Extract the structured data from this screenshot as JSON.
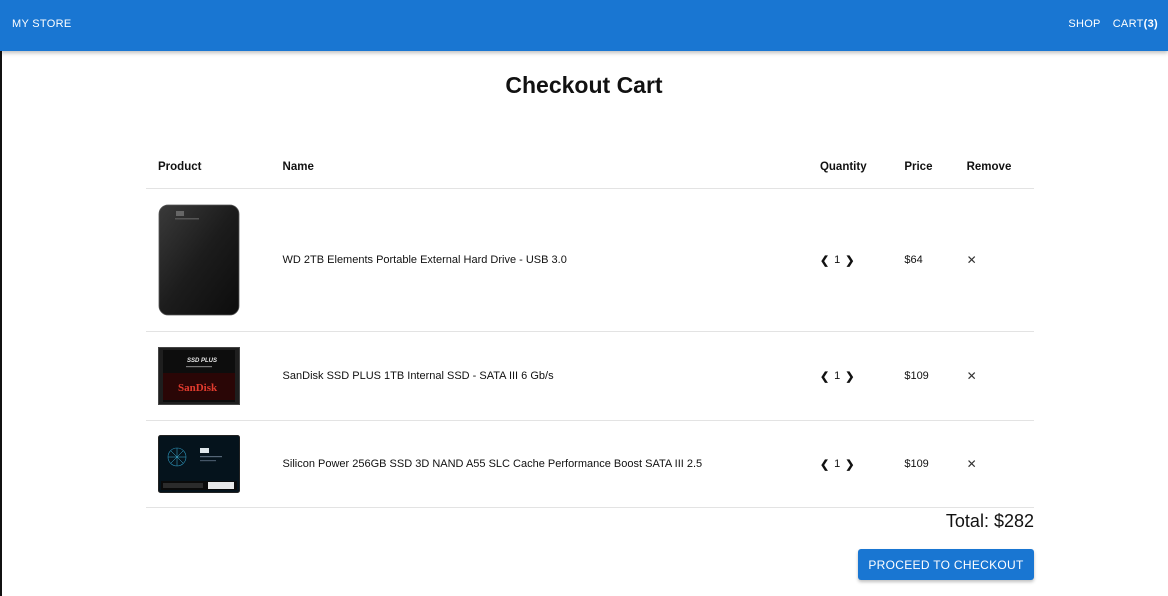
{
  "header": {
    "brand": "MY STORE",
    "nav_shop": "SHOP",
    "nav_cart": "CART",
    "cart_count": "(3)"
  },
  "page": {
    "title": "Checkout Cart"
  },
  "table": {
    "columns": [
      "Product",
      "Name",
      "Quantity",
      "Price",
      "Remove"
    ],
    "rows": [
      {
        "image": "wd-hard-drive-image",
        "name": "WD 2TB Elements Portable External Hard Drive - USB 3.0",
        "quantity": "1",
        "price": "$64"
      },
      {
        "image": "sandisk-ssd-image",
        "name": "SanDisk SSD PLUS 1TB Internal SSD - SATA III 6 Gb/s",
        "quantity": "1",
        "price": "$109",
        "image_text_1": "SSD PLUS",
        "image_text_2": "SanDisk"
      },
      {
        "image": "silicon-power-ssd-image",
        "name": "Silicon Power 256GB SSD 3D NAND A55 SLC Cache Performance Boost SATA III 2.5",
        "quantity": "1",
        "price": "$109"
      }
    ],
    "decrement_glyph": "❮",
    "increment_glyph": "❯",
    "remove_glyph": "✕"
  },
  "summary": {
    "total": "Total: $282"
  },
  "actions": {
    "checkout_label": "PROCEED TO CHECKOUT"
  },
  "colors": {
    "primary": "#1976d2",
    "background": "#ffffff",
    "text": "#111111"
  }
}
